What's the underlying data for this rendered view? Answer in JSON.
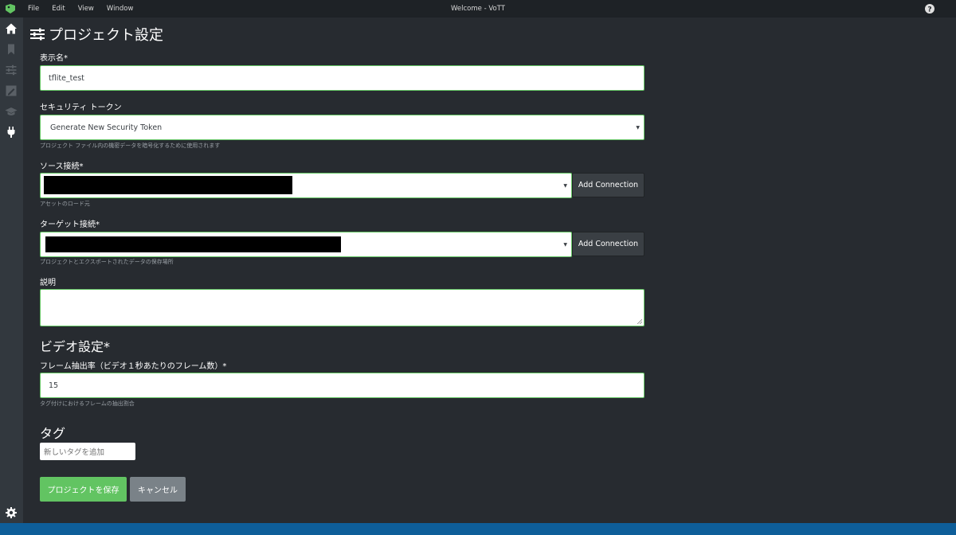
{
  "titlebar": {
    "menu": [
      "File",
      "Edit",
      "View",
      "Window"
    ],
    "window_title": "Welcome - VoTT"
  },
  "sidebar": {
    "icons": [
      "home-icon",
      "bookmark-icon",
      "sliders-icon",
      "edit-image-icon",
      "graduation-cap-icon",
      "plug-icon",
      "gear-icon"
    ]
  },
  "page": {
    "title": "プロジェクト設定"
  },
  "form": {
    "display_name": {
      "label": "表示名*",
      "value": "tflite_test"
    },
    "security_token": {
      "label": "セキュリティ トークン",
      "selected": "Generate New Security Token",
      "help": "プロジェクト ファイル内の機密データを暗号化するために使用されます"
    },
    "source_connection": {
      "label": "ソース接続*",
      "button": "Add Connection",
      "help": "アセットのロード元"
    },
    "target_connection": {
      "label": "ターゲット接続*",
      "button": "Add Connection",
      "help": "プロジェクトとエクスポートされたデータの保存場所"
    },
    "description": {
      "label": "説明",
      "value": ""
    },
    "video_settings": {
      "title": "ビデオ設定*",
      "frame_rate_label": "フレーム抽出率（ビデオ１秒あたりのフレーム数）*",
      "frame_rate_value": "15",
      "frame_rate_help": "タグ付けにおけるフレームの抽出割合"
    },
    "tags": {
      "title": "タグ",
      "placeholder": "新しいタグを追加"
    },
    "save_button": "プロジェクトを保存",
    "cancel_button": "キャンセル"
  },
  "colors": {
    "accent_green": "#62c462",
    "background": "#272b30",
    "sidebar": "#32383e",
    "statusbar": "#0e5e99"
  }
}
